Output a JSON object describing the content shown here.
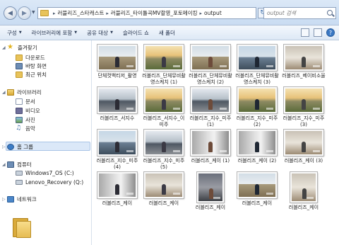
{
  "address": {
    "crumbs": [
      "러블리즈_스타캐스트",
      "러블리즈_타이틀곡MV촬영_포토메이킹",
      "output"
    ]
  },
  "search": {
    "placeholder": "output 검색"
  },
  "toolbar": {
    "items": [
      {
        "label": "구성",
        "dropdown": true
      },
      {
        "label": "라이브러리에 포함",
        "dropdown": true
      },
      {
        "label": "공유 대상",
        "dropdown": true
      },
      {
        "label": "슬라이드 쇼",
        "dropdown": false
      },
      {
        "label": "새 폴더",
        "dropdown": false
      }
    ]
  },
  "nav": {
    "favorites": {
      "label": "즐겨찾기",
      "icon": "star-icon",
      "items": [
        {
          "label": "다운로드",
          "icon": "folder-icon"
        },
        {
          "label": "바탕 화면",
          "icon": "desktop-icon"
        },
        {
          "label": "최근 위치",
          "icon": "recent-places-icon"
        }
      ]
    },
    "libraries": {
      "label": "라이브러리",
      "icon": "library-icon",
      "items": [
        {
          "label": "문서",
          "icon": "document-icon"
        },
        {
          "label": "비디오",
          "icon": "video-icon"
        },
        {
          "label": "사진",
          "icon": "picture-icon"
        },
        {
          "label": "음악",
          "icon": "music-icon"
        }
      ]
    },
    "homegroup": {
      "label": "홈 그룹",
      "icon": "homegroup-icon"
    },
    "computer": {
      "label": "컴퓨터",
      "icon": "computer-icon",
      "items": [
        {
          "label": "Windows7_OS (C:)",
          "icon": "drive-icon"
        },
        {
          "label": "Lenovo_Recovery (Q:)",
          "icon": "drive-icon"
        }
      ]
    },
    "network": {
      "label": "네트워크",
      "icon": "network-icon"
    }
  },
  "files": [
    {
      "name": "단체컷백티저_촬영",
      "scene": "sky",
      "orient": "landscape"
    },
    {
      "name": "러블리즈_단체뮤비촬영스케치 (1)",
      "scene": "sun",
      "orient": "landscape"
    },
    {
      "name": "러블리즈_단체뮤비촬영스케치 (2)",
      "scene": "sky",
      "orient": "landscape"
    },
    {
      "name": "러블리즈_단체뮤비촬영스케치 (3)",
      "scene": "sea",
      "orient": "landscape"
    },
    {
      "name": "러블리즈_베이비소울",
      "scene": "room",
      "orient": "landscape"
    },
    {
      "name": "러블리즈_서지수",
      "scene": "rail",
      "orient": "landscape"
    },
    {
      "name": "러블리즈_서지수_이미주",
      "scene": "sun",
      "orient": "landscape"
    },
    {
      "name": "러블리즈_지수_미주 (1)",
      "scene": "rail",
      "orient": "landscape"
    },
    {
      "name": "러블리즈_지수_미주 (2)",
      "scene": "sun",
      "orient": "landscape"
    },
    {
      "name": "러블리즈_지수_미주 (3)",
      "scene": "sun",
      "orient": "landscape"
    },
    {
      "name": "러블리즈_지수_미주 (4)",
      "scene": "sea",
      "orient": "landscape"
    },
    {
      "name": "러블리즈_지수_미주 (5)",
      "scene": "rail",
      "orient": "landscape"
    },
    {
      "name": "러블리즈_케이 (1)",
      "scene": "street",
      "orient": "landscape"
    },
    {
      "name": "러블리즈_케이 (2)",
      "scene": "street",
      "orient": "landscape"
    },
    {
      "name": "러블리즈_케이 (3)",
      "scene": "room",
      "orient": "landscape"
    },
    {
      "name": "러블리즈_케이",
      "scene": "street",
      "orient": "landscape"
    },
    {
      "name": "러블리즈_케이",
      "scene": "room",
      "orient": "landscape"
    },
    {
      "name": "러블리즈_케이",
      "scene": "dark",
      "orient": "portrait"
    },
    {
      "name": "러블리즈_케이",
      "scene": "sky",
      "orient": "landscape"
    },
    {
      "name": "러블리즈_케이",
      "scene": "room",
      "orient": "portrait"
    }
  ]
}
